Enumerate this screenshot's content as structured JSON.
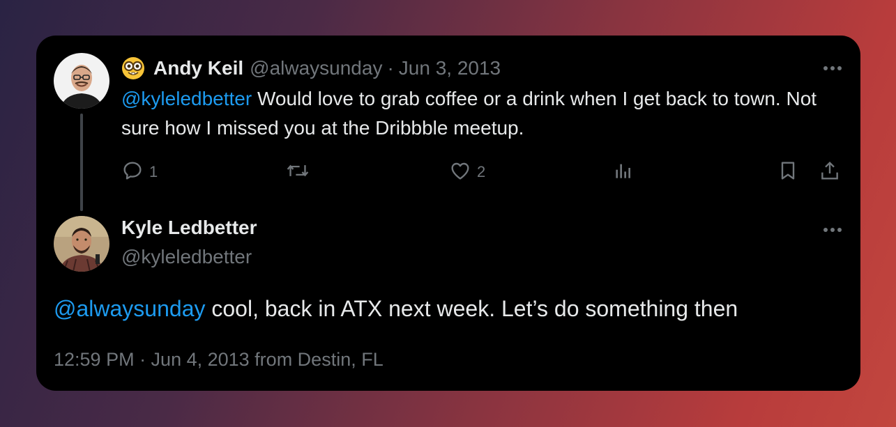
{
  "tweet1": {
    "author_name": "Andy Keil",
    "handle": "@alwaysunday",
    "separator": "·",
    "date": "Jun 3, 2013",
    "mention": "@kyleledbetter",
    "text": " Would love to grab coffee or a drink when I get back to town. Not sure how I missed you at the Dribbble meetup.",
    "emoji_icon": "nerd-face-icon",
    "stats": {
      "replies": "1",
      "likes": "2"
    }
  },
  "tweet2": {
    "author_name": "Kyle Ledbetter",
    "handle": "@kyleledbetter",
    "mention": "@alwaysunday",
    "text": " cool, back in ATX next week. Let’s do something then",
    "meta": "12:59 PM · Jun 4, 2013 from Destin, FL"
  },
  "colors": {
    "mention": "#1d9bf0",
    "primary_text": "#e7e9ea",
    "secondary_text": "#71767b",
    "card_background": "#000000"
  },
  "icons": [
    "reply-icon",
    "retweet-icon",
    "like-icon",
    "views-icon",
    "bookmark-icon",
    "share-icon",
    "more-icon"
  ]
}
